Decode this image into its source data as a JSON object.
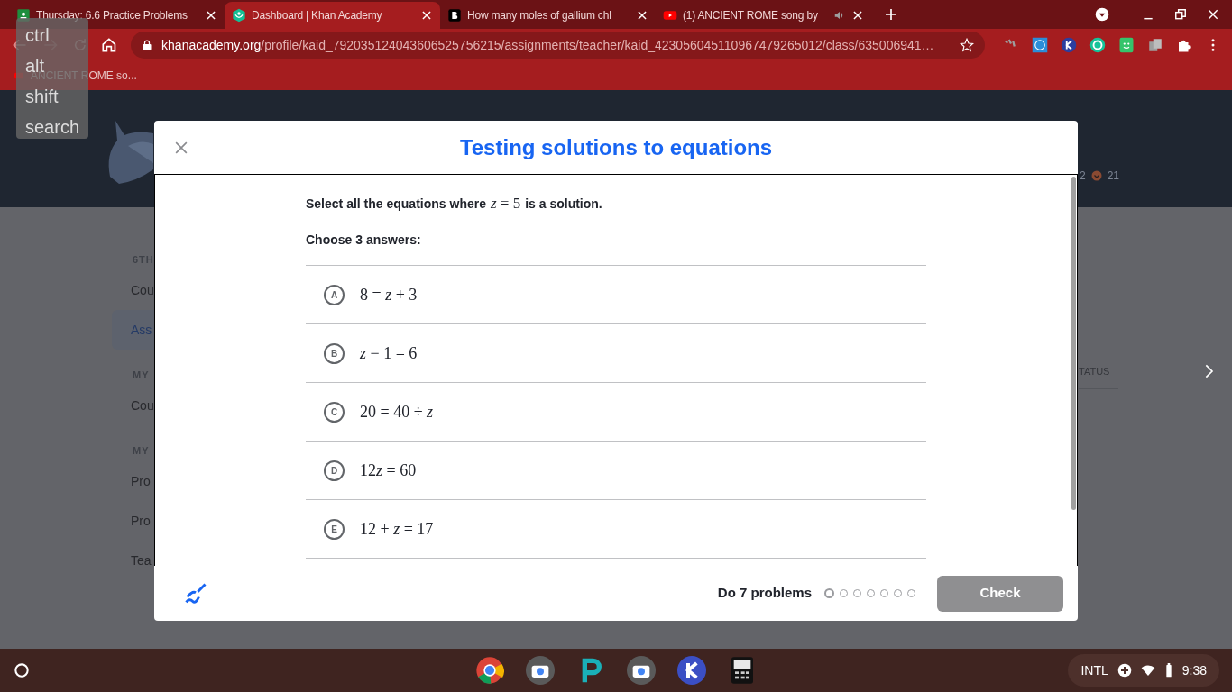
{
  "browser": {
    "tabs": [
      {
        "title": "Thursday: 6.6 Practice Problems",
        "kind": "classroom",
        "selected": false,
        "playing_audio": false
      },
      {
        "title": "Dashboard | Khan Academy",
        "kind": "khan",
        "selected": true,
        "playing_audio": false
      },
      {
        "title": "How many moles of gallium chl",
        "kind": "brainly",
        "selected": false,
        "playing_audio": false
      },
      {
        "title": "(1) ANCIENT ROME song by",
        "kind": "youtube",
        "selected": false,
        "playing_audio": true
      }
    ],
    "address": {
      "host": "khanacademy.org",
      "path": "/profile/kaid_792035124043606525756215/assignments/teacher/kaid_423056045110967479265012/class/635006941…"
    },
    "bookmarks": [
      "ANCIENT ROME so..."
    ]
  },
  "key_overlay": [
    "ctrl",
    "alt",
    "shift",
    "search"
  ],
  "background_page": {
    "header_stats": [
      "2",
      "21"
    ],
    "sidebar": [
      {
        "kind": "heading",
        "text": "6TH"
      },
      {
        "kind": "link",
        "text": "Cou",
        "selected": false
      },
      {
        "kind": "link",
        "text": "Ass",
        "selected": true
      },
      {
        "kind": "heading",
        "text": "MY"
      },
      {
        "kind": "link",
        "text": "Cou",
        "selected": false
      },
      {
        "kind": "heading",
        "text": "MY"
      },
      {
        "kind": "link",
        "text": "Pro",
        "selected": false
      },
      {
        "kind": "link",
        "text": "Pro",
        "selected": false
      },
      {
        "kind": "link",
        "text": "Tea",
        "selected": false
      }
    ],
    "column_heading": "TATUS"
  },
  "modal": {
    "title": "Testing solutions to equations",
    "question": {
      "before": "Select all the equations where",
      "math": "z = 5",
      "after": "is a solution."
    },
    "instruction": "Choose 3 answers:",
    "choices": [
      {
        "letter": "A",
        "math": "8 = z + 3",
        "selected": false
      },
      {
        "letter": "B",
        "math": "z − 1 = 6",
        "selected": false
      },
      {
        "letter": "C",
        "math": "20 = 40 ÷ z",
        "selected": false
      },
      {
        "letter": "D",
        "math": "12z = 60",
        "selected": false
      },
      {
        "letter": "E",
        "math": "12 + z = 17",
        "selected": false
      }
    ],
    "footer": {
      "task": "Do 7 problems",
      "problems": [
        {
          "current": true
        },
        {
          "current": false
        },
        {
          "current": false
        },
        {
          "current": false
        },
        {
          "current": false
        },
        {
          "current": false
        },
        {
          "current": false
        }
      ],
      "check_button": {
        "label": "Check",
        "disabled": true
      }
    }
  },
  "shelf": {
    "input_method": "INTL",
    "time": "9:38"
  }
}
